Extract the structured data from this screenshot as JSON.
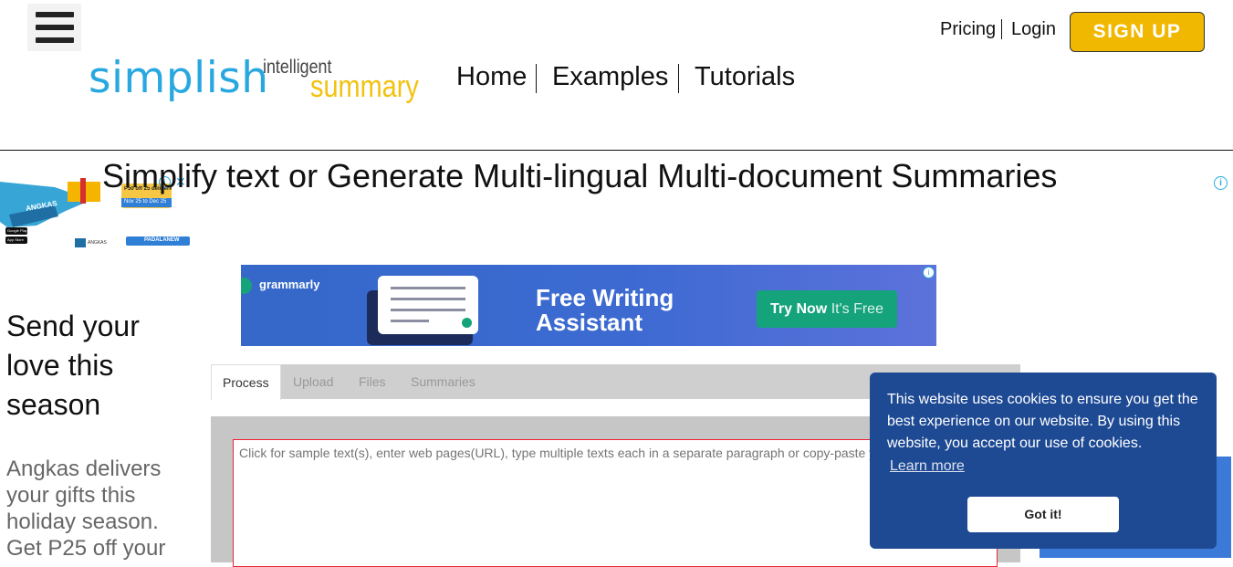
{
  "header": {
    "logo_primary": "simplish",
    "logo_secondary_top": "intelligent",
    "logo_secondary_bottom": "summary",
    "nav": [
      "Home",
      "Examples",
      "Tutorials"
    ],
    "pricing": "Pricing",
    "login": "Login",
    "signup": "SIGN UP"
  },
  "headline": "Simplify text or Generate Multi-lingual Multi-document Summaries",
  "ad_small": {
    "brand": "ANGKAS",
    "promo": "P50 off 25 deliveries",
    "dates": "Nov 25 to Dec 25",
    "code": "PADALANEW",
    "store_badges": [
      "Google Play",
      "App Store"
    ]
  },
  "ad_sidebar": {
    "headline": "Send your love this season",
    "body": "Angkas delivers your gifts this holiday season. Get P25 off your"
  },
  "grammarly_ad": {
    "brand": "grammarly",
    "title_line1": "Free Writing",
    "title_line2": "Assistant",
    "cta_bold": "Try Now",
    "cta_light": "It's Free"
  },
  "tabs": [
    {
      "label": "Process",
      "active": true
    },
    {
      "label": "Upload",
      "active": false
    },
    {
      "label": "Files",
      "active": false
    },
    {
      "label": "Summaries",
      "active": false
    }
  ],
  "input": {
    "placeholder": "Click for sample text(s), enter web pages(URL), type multiple texts each in a separate paragraph or copy-paste your text(s)"
  },
  "cookie": {
    "message": "This website uses cookies to ensure you get the best experience on our website. By using this website, you accept our use of cookies.",
    "learn_more": "Learn more",
    "button": "Got it!"
  },
  "colors": {
    "brand_blue": "#29a8e0",
    "brand_yellow": "#f2c20f",
    "signup": "#f0b800",
    "cookie_bg": "#1e4a94",
    "grammarly_cta": "#15a37b"
  }
}
